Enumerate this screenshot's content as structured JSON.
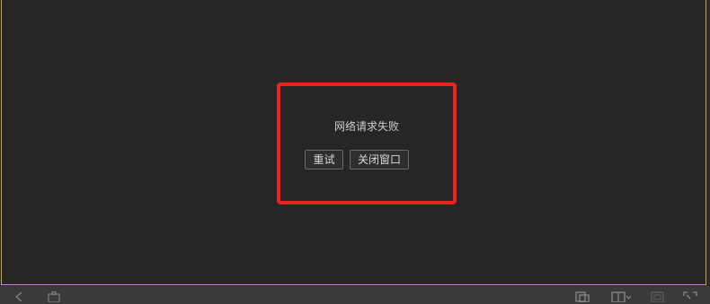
{
  "error_dialog": {
    "message": "网络请求失败",
    "retry_label": "重试",
    "close_label": "关闭窗口"
  },
  "colors": {
    "highlight_border": "#e8261e",
    "window_border": "#c9a24a",
    "background": "#262626"
  },
  "toolbar": {
    "icons": [
      "arrow-left-icon",
      "puzzle-icon",
      "copy-icon",
      "layout-icon",
      "window-icon",
      "fullscreen-icon"
    ]
  }
}
